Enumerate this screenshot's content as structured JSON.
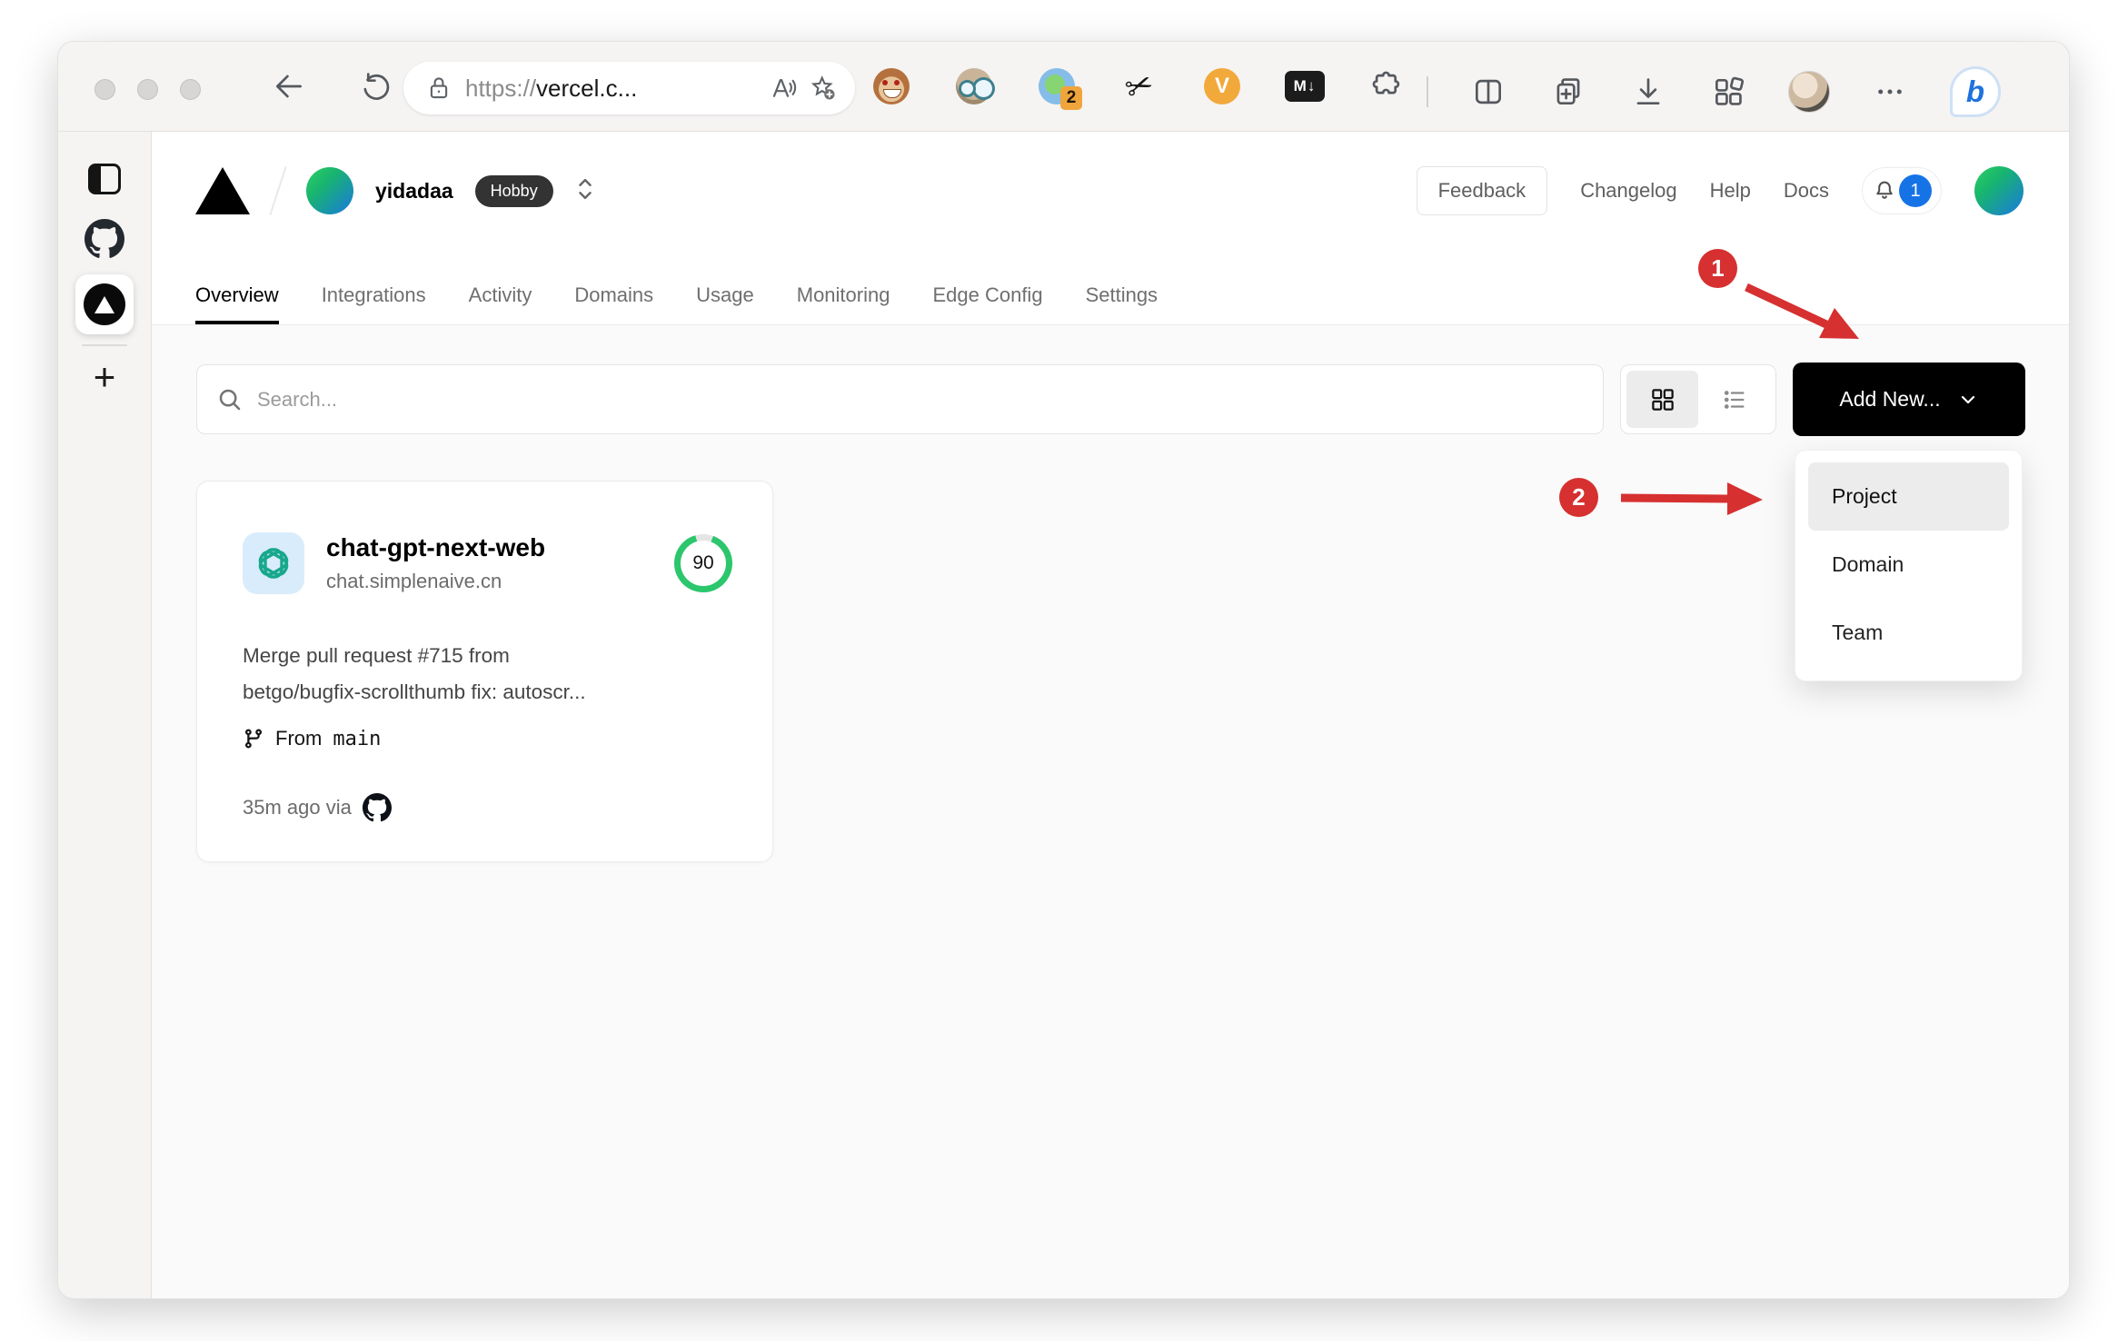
{
  "browser": {
    "url": {
      "scheme": "https://",
      "host": "vercel.c..."
    },
    "extensions": {
      "translate_badge": "2",
      "v_label": "V",
      "markdown_label": "M↓"
    },
    "bing_label": "b"
  },
  "vercel": {
    "team": {
      "name": "yidadaa",
      "plan": "Hobby"
    },
    "header": {
      "feedback": "Feedback",
      "changelog": "Changelog",
      "help": "Help",
      "docs": "Docs",
      "notification_count": "1"
    },
    "tabs": [
      "Overview",
      "Integrations",
      "Activity",
      "Domains",
      "Usage",
      "Monitoring",
      "Edge Config",
      "Settings"
    ],
    "toolbar": {
      "search_placeholder": "Search...",
      "add_new_label": "Add New..."
    },
    "dropdown": {
      "items": [
        "Project",
        "Domain",
        "Team"
      ]
    },
    "project_card": {
      "name": "chat-gpt-next-web",
      "domain": "chat.simplenaive.cn",
      "score": "90",
      "commit_line1": "Merge pull request #715 from",
      "commit_line2": "betgo/bugfix-scrollthumb fix: autoscr...",
      "branch_prefix": "From",
      "branch_name": "main",
      "deployed": "35m ago via"
    }
  },
  "annotations": {
    "step1": "1",
    "step2": "2",
    "arrow_color": "#d63030",
    "notification_blue": "#1673e6",
    "score_green": "#2cc66d"
  }
}
